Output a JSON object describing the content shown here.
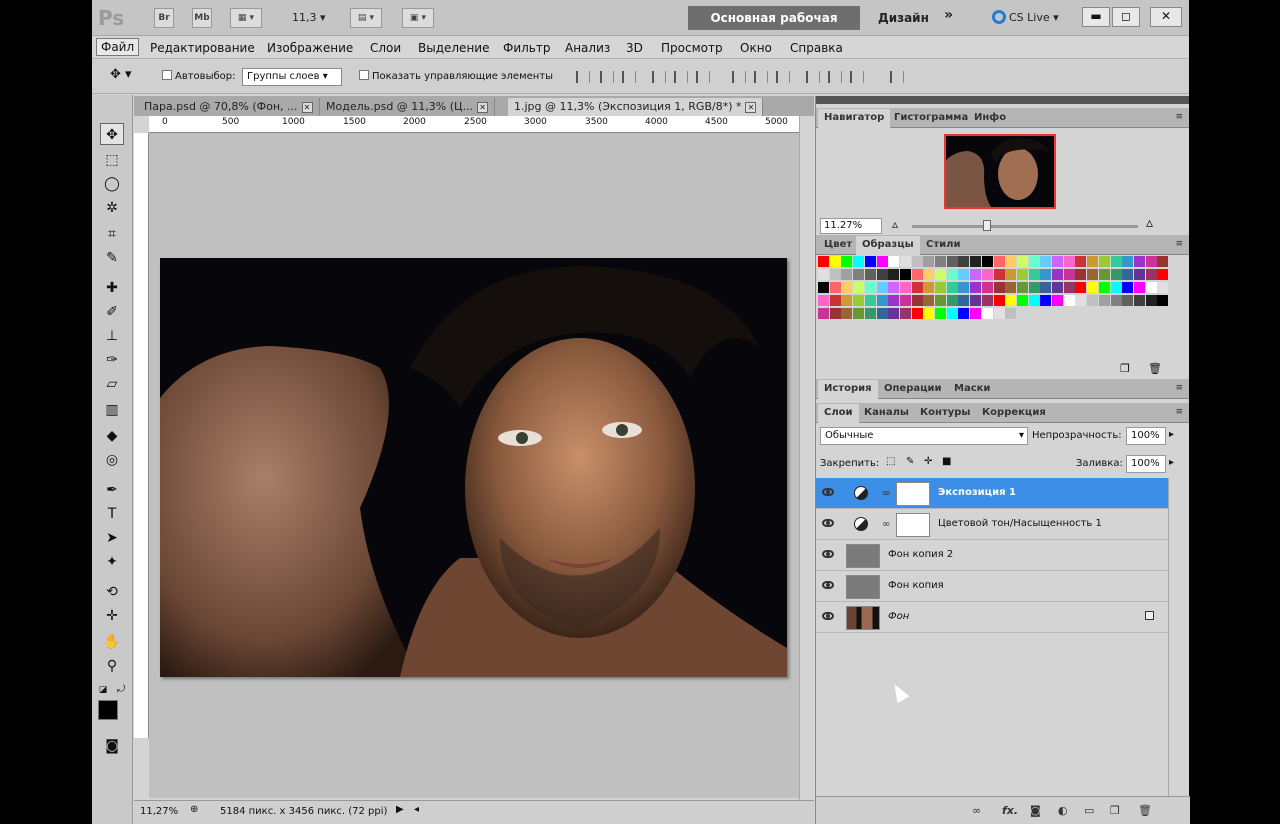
{
  "appbar": {
    "logo": "Ps",
    "br": "Br",
    "mb": "Mb",
    "zoom": "11,3",
    "workspace_main": "Основная рабочая среда",
    "workspace_2": "Дизайн",
    "more": "»",
    "cslive": "CS Live"
  },
  "menu": [
    "Файл",
    "Редактирование",
    "Изображение",
    "Слои",
    "Выделение",
    "Фильтр",
    "Анализ",
    "3D",
    "Просмотр",
    "Окно",
    "Справка"
  ],
  "options": {
    "autoselect_label": "Автовыбор:",
    "autoselect_value": "Группы слоев",
    "show_controls": "Показать управляющие элементы"
  },
  "tabs": [
    {
      "label": "Пара.psd @ 70,8% (Фон, ..."
    },
    {
      "label": "Модель.psd @ 11,3% (Ц..."
    },
    {
      "label": "1.jpg @ 11,3% (Экспозиция 1, RGB/8*) *"
    }
  ],
  "ruler": [
    "0",
    "500",
    "1000",
    "1500",
    "2000",
    "2500",
    "3000",
    "3500",
    "4000",
    "4500",
    "5000"
  ],
  "status": {
    "zoom": "11,27%",
    "doc": "5184 пикс. x 3456 пикс. (72 ppi)"
  },
  "navigator": {
    "tabs": [
      "Навигатор",
      "Гистограмма",
      "Инфо"
    ],
    "zoom": "11.27%",
    "zoom_level": 0.33
  },
  "color_panel": {
    "tabs": [
      "Цвет",
      "Образцы",
      "Стили"
    ]
  },
  "history_panel": {
    "tabs": [
      "История",
      "Операции",
      "Маски"
    ]
  },
  "layers_panel": {
    "tabs": [
      "Слои",
      "Каналы",
      "Контуры",
      "Коррекция"
    ],
    "blend_mode": "Обычные",
    "opacity_label": "Непрозрачность:",
    "opacity": "100%",
    "lock_label": "Закрепить:",
    "fill_label": "Заливка:",
    "fill": "100%",
    "layers": [
      {
        "name": "Экспозиция 1",
        "type": "adjustment",
        "selected": true
      },
      {
        "name": "Цветовой тон/Насыщенность 1",
        "type": "adjustment",
        "selected": false
      },
      {
        "name": "Фон копия 2",
        "type": "gray",
        "selected": false
      },
      {
        "name": "Фон копия",
        "type": "gray",
        "selected": false
      },
      {
        "name": "Фон",
        "type": "photo",
        "selected": false,
        "locked": true
      }
    ]
  },
  "colors": {
    "accent": "#3d8ee6",
    "workspace_btn": "#6e6e6e"
  }
}
